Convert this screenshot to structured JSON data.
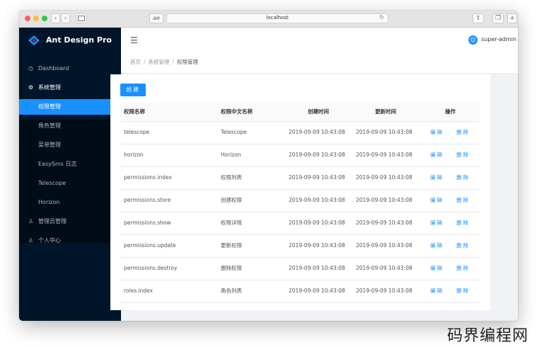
{
  "browser": {
    "url": "localhost",
    "address_left_label": "ae"
  },
  "app": {
    "title": "Ant Design Pro",
    "username": "super-admin"
  },
  "menu": {
    "dashboard": "Dashboard",
    "system": "系统管理",
    "system_children": [
      "权限管理",
      "角色管理",
      "菜单管理",
      "EasySms 日志",
      "Telescope",
      "Horizon"
    ],
    "admin": "管理员管理",
    "profile": "个人中心"
  },
  "breadcrumb": [
    "首页",
    "系统管理",
    "权限管理"
  ],
  "toolbar": {
    "create_label": "创建"
  },
  "table": {
    "columns": [
      "权限名称",
      "权限中文名称",
      "创建时间",
      "更新时间",
      "操作"
    ],
    "edit_label": "编辑",
    "delete_label": "删除",
    "rows": [
      {
        "name": "telescope",
        "cn_name": "Telescope",
        "created": "2019-09-09 10:43:08",
        "updated": "2019-09-09 10:43:08"
      },
      {
        "name": "horizon",
        "cn_name": "Horizon",
        "created": "2019-09-09 10:43:08",
        "updated": "2019-09-09 10:43:08"
      },
      {
        "name": "permissions.index",
        "cn_name": "权限列表",
        "created": "2019-09-09 10:43:08",
        "updated": "2019-09-09 10:43:08"
      },
      {
        "name": "permissions.store",
        "cn_name": "创建权限",
        "created": "2019-09-09 10:43:08",
        "updated": "2019-09-09 10:43:08"
      },
      {
        "name": "permissions.show",
        "cn_name": "权限详情",
        "created": "2019-09-09 10:43:08",
        "updated": "2019-09-09 10:43:08"
      },
      {
        "name": "permissions.update",
        "cn_name": "更新权限",
        "created": "2019-09-09 10:43:08",
        "updated": "2019-09-09 10:43:08"
      },
      {
        "name": "permissions.destroy",
        "cn_name": "删除权限",
        "created": "2019-09-09 10:43:08",
        "updated": "2019-09-09 10:43:08"
      },
      {
        "name": "roles.index",
        "cn_name": "角色列表",
        "created": "2019-09-09 10:43:08",
        "updated": "2019-09-09 10:43:08"
      }
    ]
  },
  "watermark": "码界编程网",
  "colors": {
    "primary": "#1890ff",
    "sider": "#001529",
    "sider_sub": "#000c17"
  }
}
